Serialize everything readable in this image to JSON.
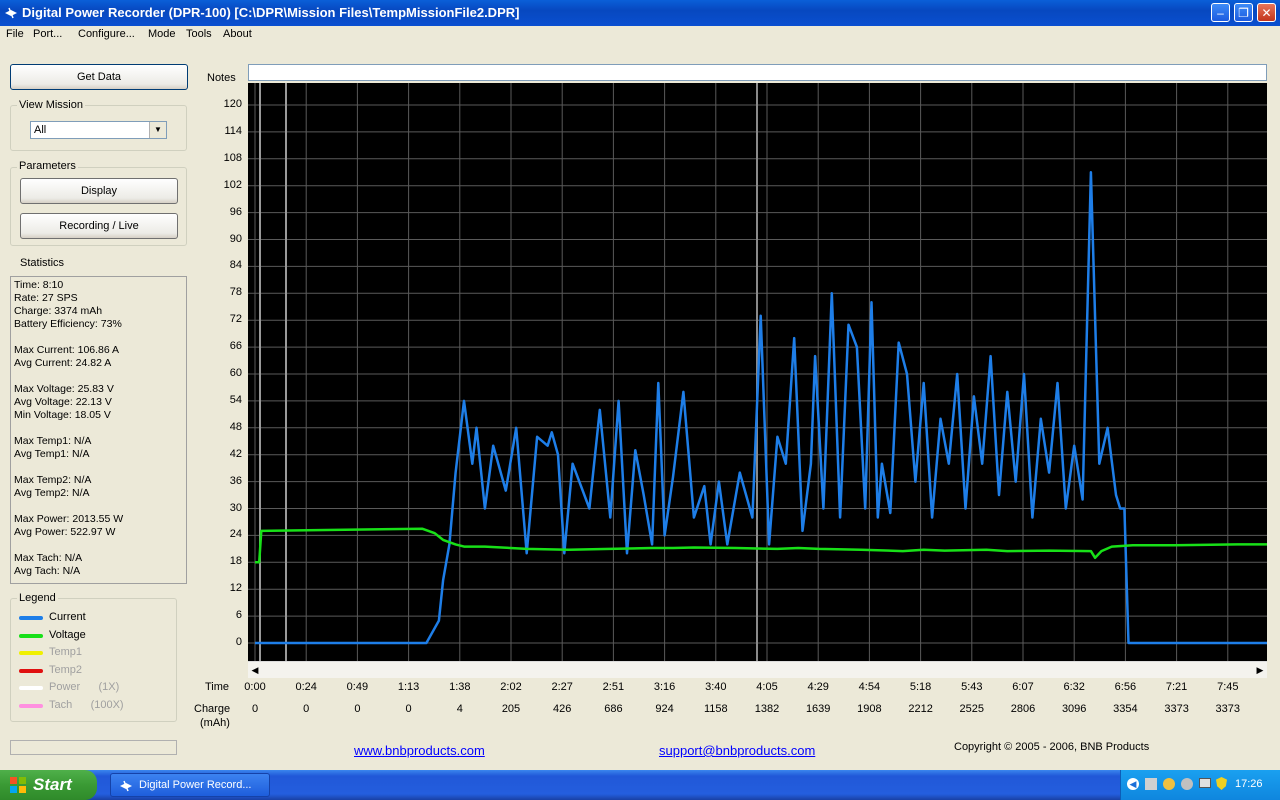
{
  "window": {
    "title": "Digital Power Recorder (DPR-100) [C:\\DPR\\Mission Files\\TempMissionFile2.DPR]"
  },
  "menu": [
    "File",
    "Port...",
    "Configure...",
    "Mode",
    "Tools",
    "About"
  ],
  "left_panel": {
    "get_data_label": "Get Data",
    "view_mission_label": "View Mission",
    "view_mission_value": "All",
    "parameters_label": "Parameters",
    "display_label": "Display",
    "recording_label": "Recording / Live",
    "statistics_label": "Statistics",
    "statistics": [
      "Time: 8:10",
      "Rate: 27 SPS",
      "Charge: 3374 mAh",
      "Battery Efficiency: 73%",
      "",
      "Max Current: 106.86 A",
      "Avg Current: 24.82 A",
      "",
      "Max Voltage: 25.83 V",
      "Avg Voltage: 22.13 V",
      "Min Voltage: 18.05 V",
      "",
      "Max Temp1: N/A",
      "Avg Temp1: N/A",
      "",
      "Max Temp2: N/A",
      "Avg Temp2: N/A",
      "",
      "Max Power: 2013.55 W",
      "Avg Power: 522.97 W",
      "",
      "Max Tach: N/A",
      "Avg Tach: N/A"
    ],
    "legend_label": "Legend",
    "legend": [
      {
        "label": "Current",
        "suffix": "",
        "color": "#1e7ee8",
        "text_color": "#000000"
      },
      {
        "label": "Voltage",
        "suffix": "",
        "color": "#18e018",
        "text_color": "#000000"
      },
      {
        "label": "Temp1",
        "suffix": "",
        "color": "#f0f000",
        "text_color": "#a0a0a0"
      },
      {
        "label": "Temp2",
        "suffix": "",
        "color": "#e01010",
        "text_color": "#a0a0a0"
      },
      {
        "label": "Power",
        "suffix": "(1X)",
        "color": "#ffffff",
        "text_color": "#a0a0a0"
      },
      {
        "label": "Tach",
        "suffix": "(100X)",
        "color": "#ff90e0",
        "text_color": "#a0a0a0"
      }
    ]
  },
  "notes": {
    "label": "Notes",
    "value": ""
  },
  "footer": {
    "website": "www.bnbproducts.com",
    "support": "support@bnbproducts.com",
    "copyright": "Copyright © 2005 - 2006, BNB Products"
  },
  "taskbar": {
    "start_label": "Start",
    "task_label": "Digital Power Record...",
    "clock": "17:26"
  },
  "chart_data": {
    "type": "line",
    "ylim": [
      0,
      120
    ],
    "y_ticks": [
      0,
      6,
      12,
      18,
      24,
      30,
      36,
      42,
      48,
      54,
      60,
      66,
      72,
      78,
      84,
      90,
      96,
      102,
      108,
      114,
      120
    ],
    "xlabel": "Time",
    "x_ticks": [
      "0:00",
      "0:24",
      "0:49",
      "1:13",
      "1:38",
      "2:02",
      "2:27",
      "2:51",
      "3:16",
      "3:40",
      "4:05",
      "4:29",
      "4:54",
      "5:18",
      "5:43",
      "6:07",
      "6:32",
      "6:56",
      "7:21",
      "7:45"
    ],
    "charge_label": "Charge",
    "charge_unit": "(mAh)",
    "charge_values": [
      "0",
      "0",
      "0",
      "0",
      "4",
      "205",
      "426",
      "686",
      "924",
      "1158",
      "1382",
      "1639",
      "1908",
      "2212",
      "2525",
      "2806",
      "3096",
      "3354",
      "3373",
      "3373"
    ],
    "x_unit": "seconds",
    "x_max": 490,
    "series": [
      {
        "name": "Current",
        "color": "#1e7ee8",
        "x": [
          0,
          60,
          82,
          88,
          90,
          93,
          96,
          100,
          104,
          106,
          110,
          114,
          120,
          125,
          130,
          135,
          140,
          142,
          145,
          148,
          152,
          160,
          165,
          170,
          174,
          178,
          182,
          186,
          190,
          193,
          196,
          200,
          205,
          210,
          215,
          218,
          222,
          226,
          232,
          238,
          242,
          246,
          250,
          254,
          258,
          262,
          266,
          268,
          272,
          276,
          280,
          284,
          288,
          292,
          295,
          298,
          300,
          304,
          308,
          312,
          316,
          320,
          324,
          328,
          332,
          336,
          340,
          344,
          348,
          352,
          356,
          360,
          364,
          368,
          372,
          376,
          380,
          384,
          388,
          392,
          396,
          400,
          404,
          408,
          412,
          414,
          416,
          418,
          420,
          424,
          426,
          428,
          430,
          440,
          470,
          490
        ],
        "y": [
          0,
          0,
          0,
          5,
          14,
          22,
          38,
          54,
          40,
          48,
          30,
          44,
          34,
          48,
          20,
          46,
          44,
          47,
          42,
          20,
          40,
          30,
          52,
          28,
          54,
          20,
          43,
          33,
          22,
          58,
          24,
          37,
          56,
          28,
          35,
          22,
          36,
          22,
          38,
          28,
          73,
          22,
          46,
          40,
          68,
          25,
          40,
          64,
          30,
          78,
          28,
          71,
          66,
          30,
          76,
          28,
          40,
          29,
          67,
          60,
          36,
          58,
          28,
          50,
          40,
          60,
          30,
          55,
          40,
          64,
          33,
          56,
          36,
          60,
          28,
          50,
          38,
          58,
          30,
          44,
          32,
          105,
          40,
          48,
          33,
          30,
          30,
          0,
          0,
          0,
          0,
          0,
          0,
          0,
          0,
          0
        ]
      },
      {
        "name": "Voltage",
        "color": "#18e018",
        "x": [
          0,
          2,
          3,
          80,
          86,
          90,
          96,
          100,
          110,
          130,
          150,
          170,
          190,
          200,
          210,
          230,
          250,
          260,
          270,
          290,
          310,
          320,
          330,
          350,
          360,
          380,
          400,
          402,
          405,
          410,
          420,
          440,
          470,
          490
        ],
        "y": [
          18,
          18,
          25,
          25.5,
          24.5,
          23,
          22,
          21.5,
          21.5,
          21,
          20.8,
          21,
          21.2,
          21.2,
          21.3,
          21.2,
          21,
          21.2,
          21,
          20.8,
          20.5,
          20.8,
          20.6,
          20.8,
          20.5,
          20.6,
          20.5,
          19,
          20.5,
          21.5,
          21.8,
          21.8,
          22,
          22
        ]
      }
    ]
  }
}
